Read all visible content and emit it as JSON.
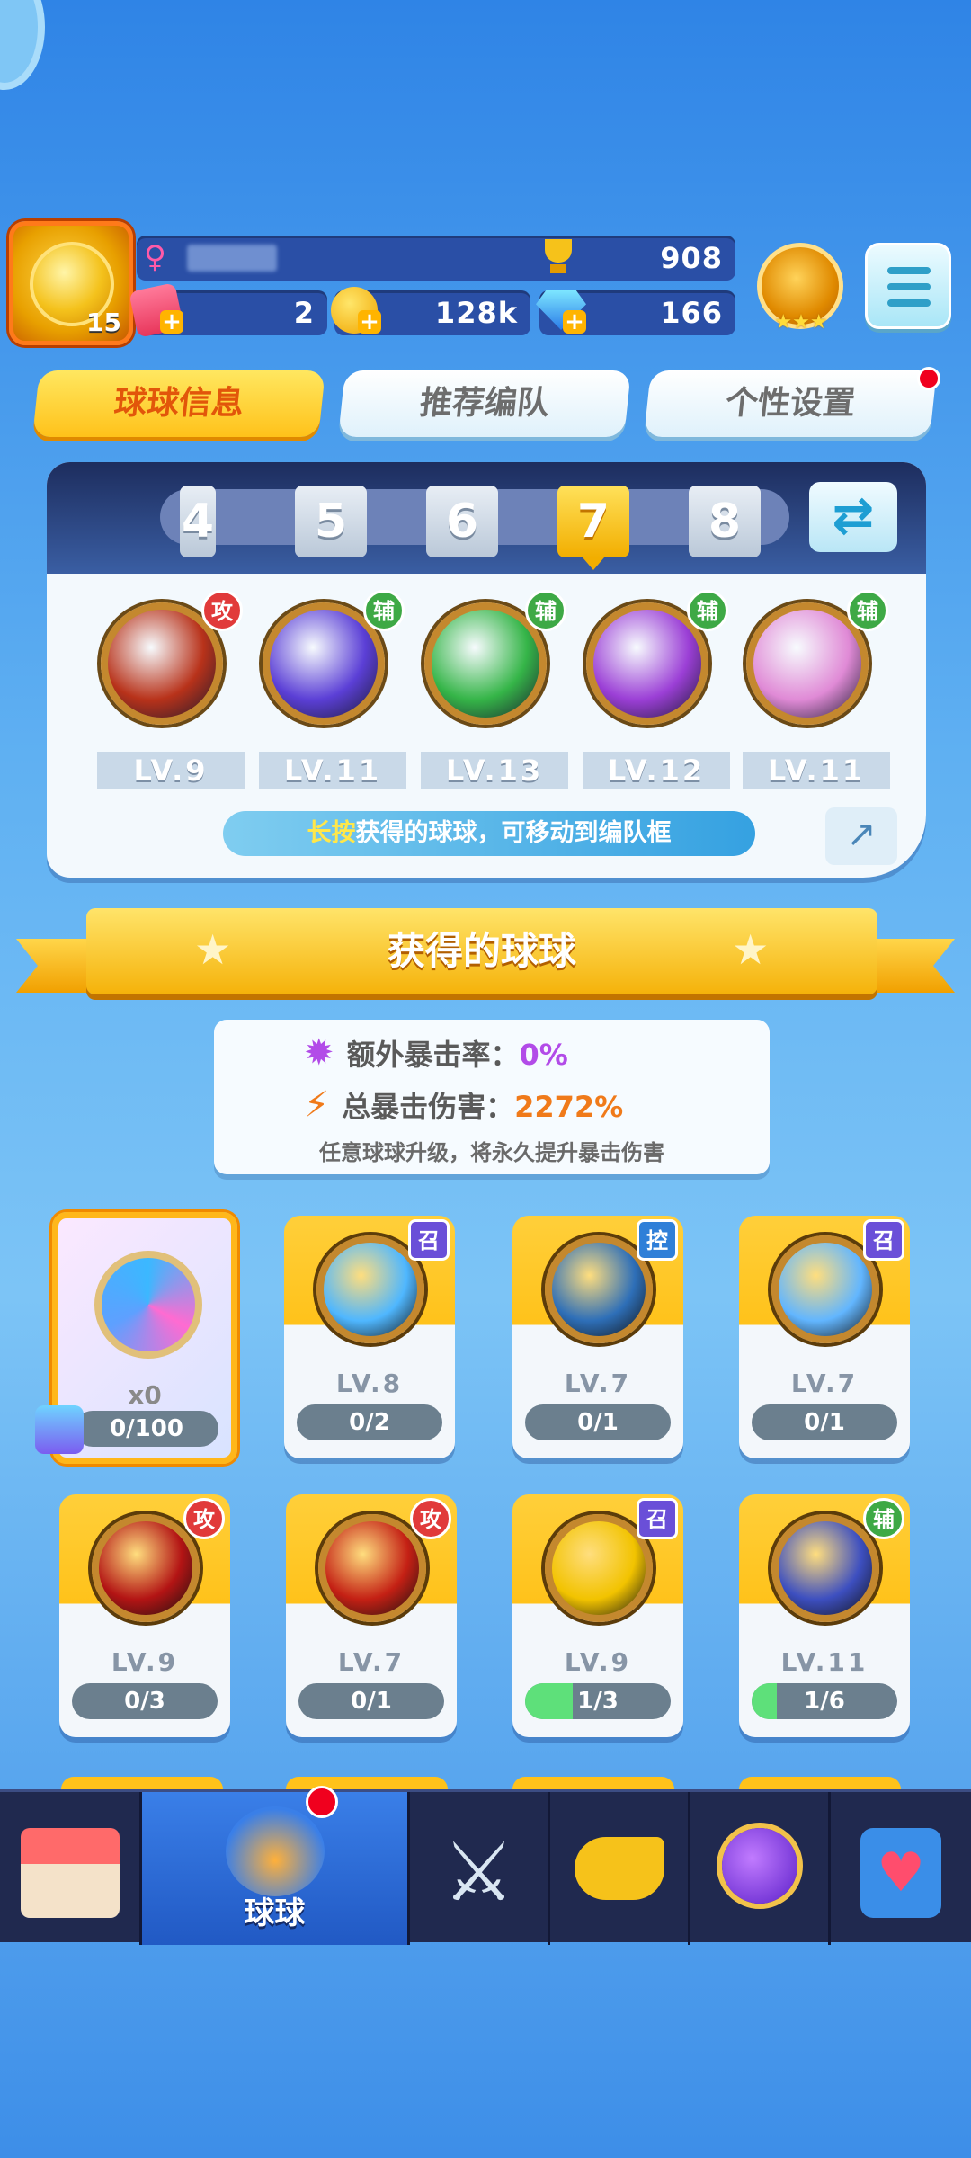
{
  "top_bar": {
    "avatar_level": "15",
    "gender_icon": "♀",
    "trophies": "908",
    "tickets": "2",
    "gold": "128k",
    "gems": "166"
  },
  "tabs": [
    {
      "label": "球球信息",
      "active": true
    },
    {
      "label": "推荐编队",
      "active": false
    },
    {
      "label": "个性设置",
      "active": false
    }
  ],
  "team": {
    "numbers": [
      "4",
      "5",
      "6",
      "7",
      "8"
    ],
    "active_number": "7",
    "balls": [
      {
        "role": "攻",
        "level": "LV.9",
        "color": "#b8321a"
      },
      {
        "role": "辅",
        "level": "LV.11",
        "color": "#5b3fd6"
      },
      {
        "role": "辅",
        "level": "LV.13",
        "color": "#35b548"
      },
      {
        "role": "辅",
        "level": "LV.12",
        "color": "#9b3fd6"
      },
      {
        "role": "辅",
        "level": "LV.11",
        "color": "#e08ad6"
      }
    ],
    "hint_bold": "长按",
    "hint_rest": "获得的球球，可移动到编队框"
  },
  "section_title": "获得的球球",
  "crit": {
    "extra_rate_label": "额外暴击率：",
    "extra_rate_value": "0%",
    "total_damage_label": "总暴击伤害：",
    "total_damage_value": "2272%",
    "note": "任意球球升级，将永久提升暴击伤害"
  },
  "special_card": {
    "count": "x0",
    "progress": "0/100"
  },
  "cards": [
    {
      "role": "召",
      "level": "LV.8",
      "progress": "0/2",
      "fill": 0,
      "color": "#4fb7ff"
    },
    {
      "role": "控",
      "level": "LV.7",
      "progress": "0/1",
      "fill": 0,
      "color": "#2e6fb8"
    },
    {
      "role": "召",
      "level": "LV.7",
      "progress": "0/1",
      "fill": 0,
      "color": "#62b6ff"
    },
    {
      "role": "攻",
      "level": "LV.9",
      "progress": "0/3",
      "fill": 0,
      "color": "#b31414"
    },
    {
      "role": "攻",
      "level": "LV.7",
      "progress": "0/1",
      "fill": 0,
      "color": "#c42014"
    },
    {
      "role": "召",
      "level": "LV.9",
      "progress": "1/3",
      "fill": 0.33,
      "color": "#f2c300"
    },
    {
      "role": "辅",
      "level": "LV.11",
      "progress": "1/6",
      "fill": 0.17,
      "color": "#3d4fc0"
    }
  ],
  "nav": {
    "items": [
      {
        "name": "shop",
        "label": ""
      },
      {
        "name": "balls",
        "label": "球球"
      },
      {
        "name": "battle",
        "label": ""
      },
      {
        "name": "whistle",
        "label": ""
      },
      {
        "name": "planet",
        "label": ""
      },
      {
        "name": "social",
        "label": ""
      }
    ]
  }
}
